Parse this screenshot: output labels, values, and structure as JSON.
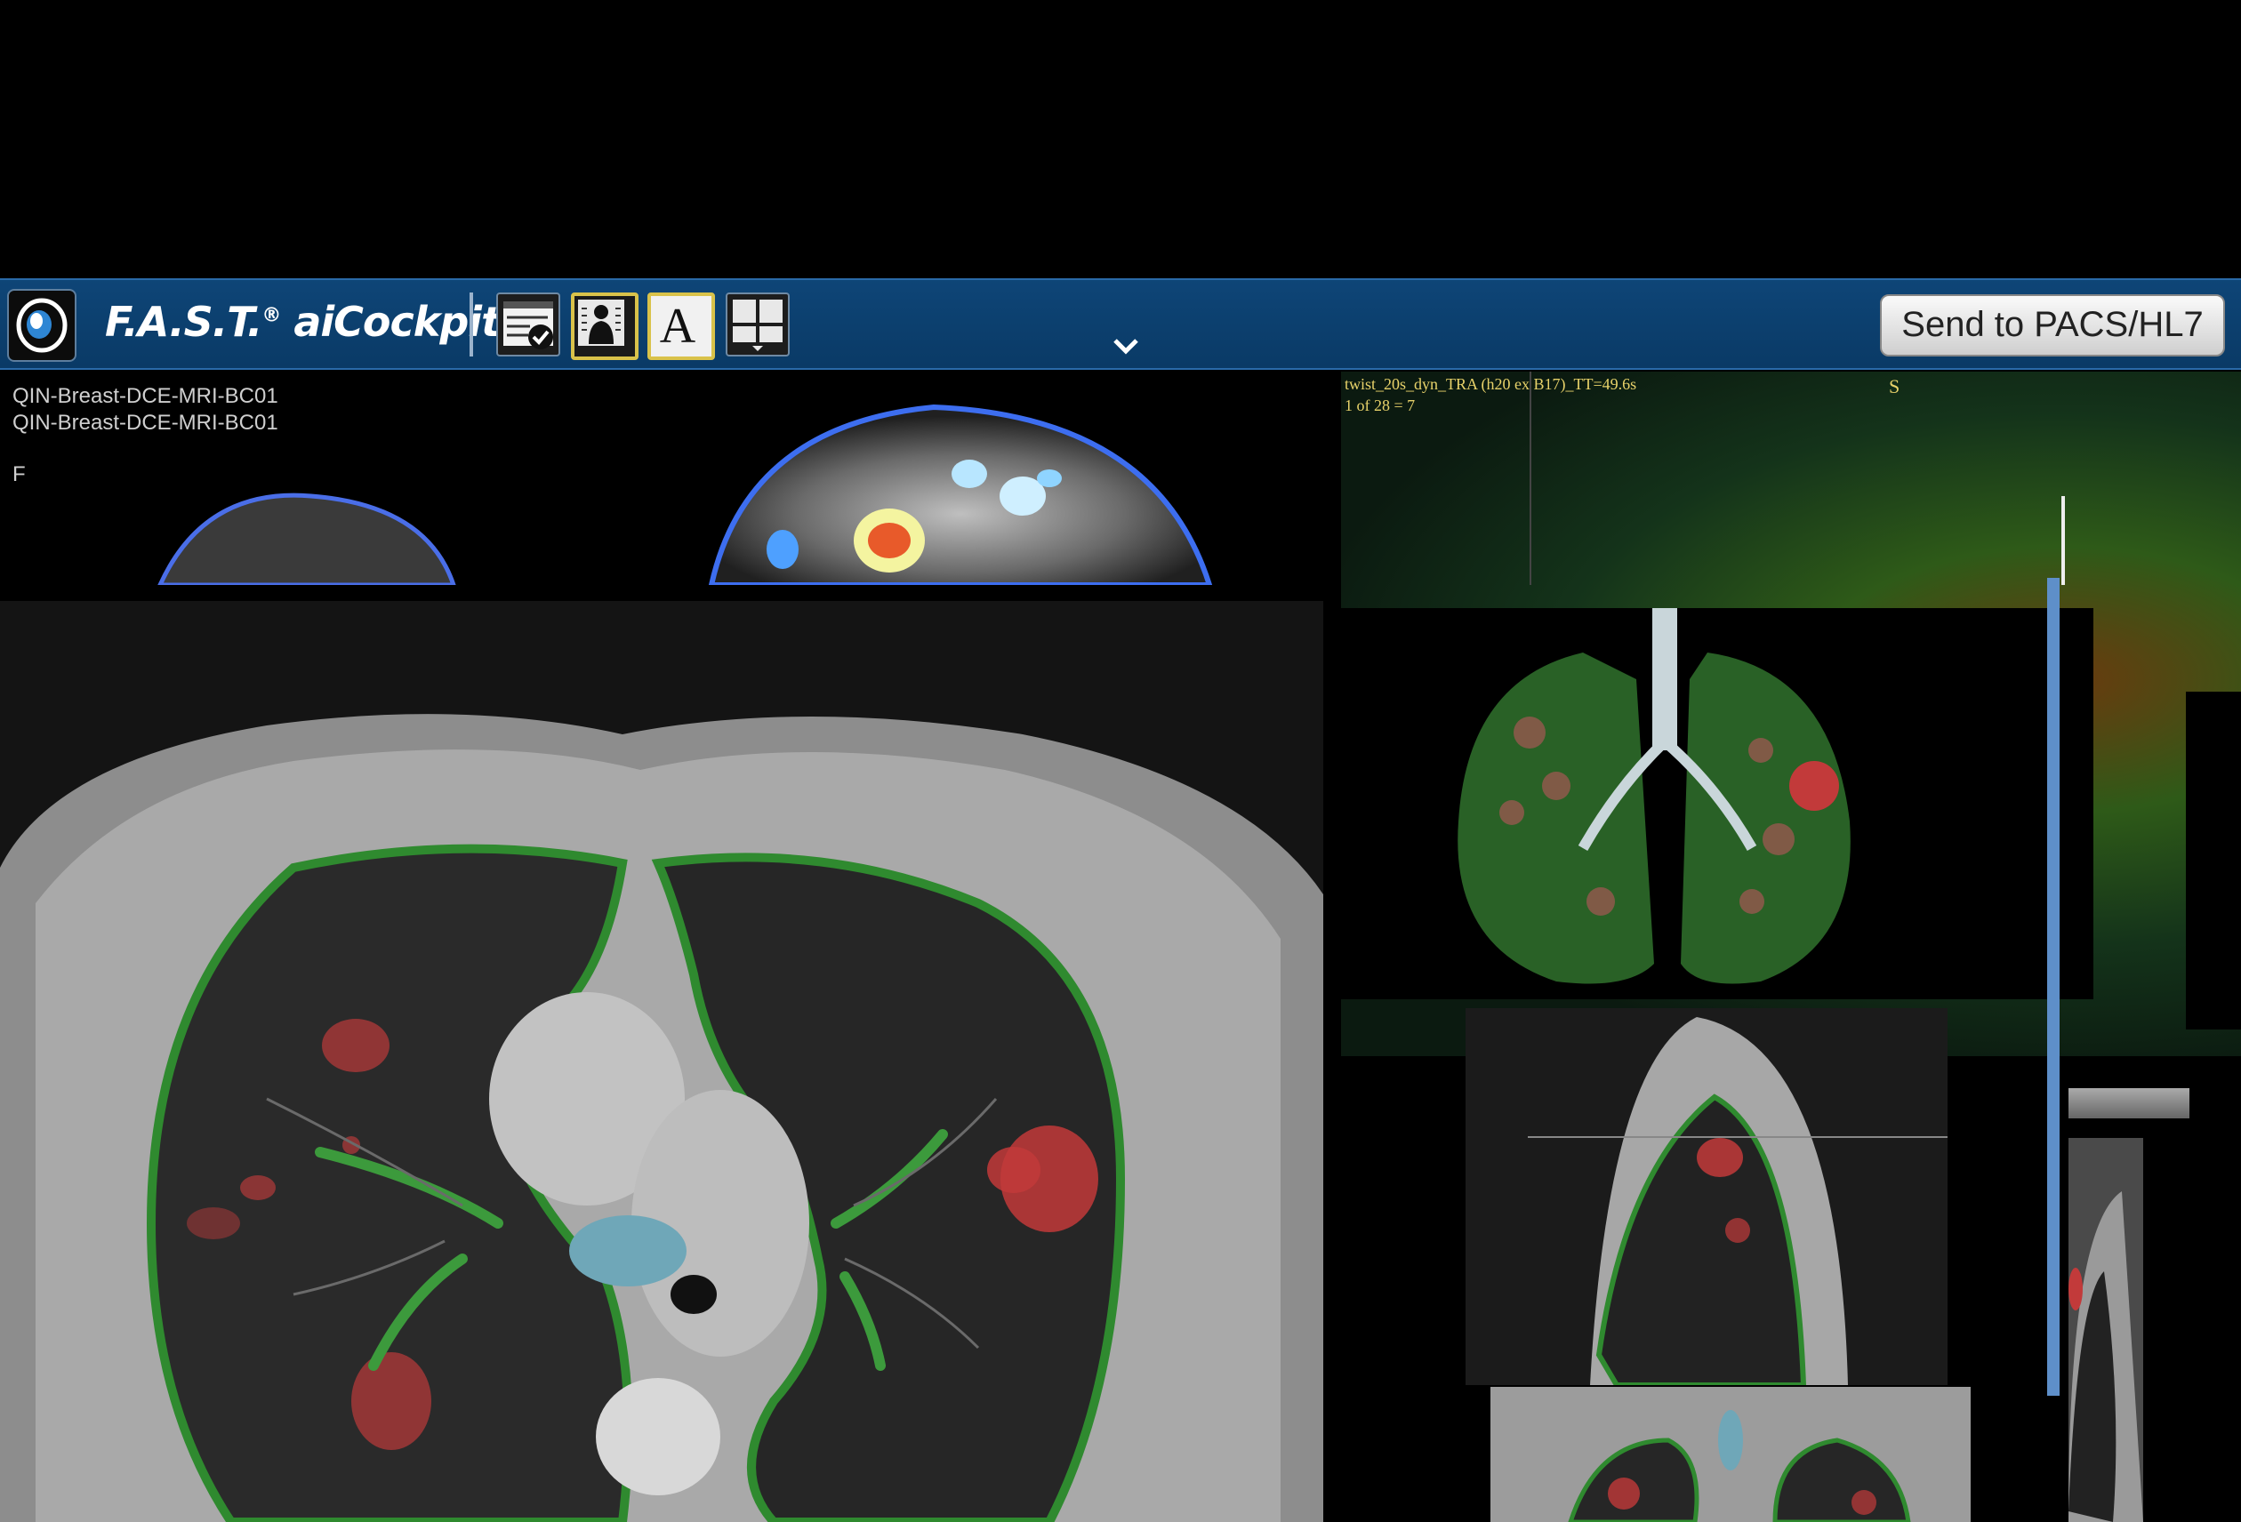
{
  "app": {
    "brand_name": "F.A.S.T.",
    "brand_product": "aiCockpit",
    "registered": "®",
    "send_button": "Send to PACS/HL7"
  },
  "toolbar_icons": [
    "logo-icon",
    "checklist-icon",
    "patient-icon",
    "text-tool-icon",
    "layout-icon",
    "chevron-down-icon"
  ],
  "mri_viewport": {
    "line1": "QIN-Breast-DCE-MRI-BC01",
    "line2": "QIN-Breast-DCE-MRI-BC01",
    "orientation": "F"
  },
  "perfusion_viewport": {
    "series": "twist_20s_dyn_TRA (h20 ex B17)_TT=49.6s",
    "frame": "1 of 28 = 7",
    "orientation": "S"
  },
  "colors": {
    "toolbar": "#0e4577",
    "accent_yellow": "#d9c24a",
    "lesion": "#c23a3a",
    "lung_outline": "#2f8a2f",
    "airway": "#6fa7b8"
  }
}
